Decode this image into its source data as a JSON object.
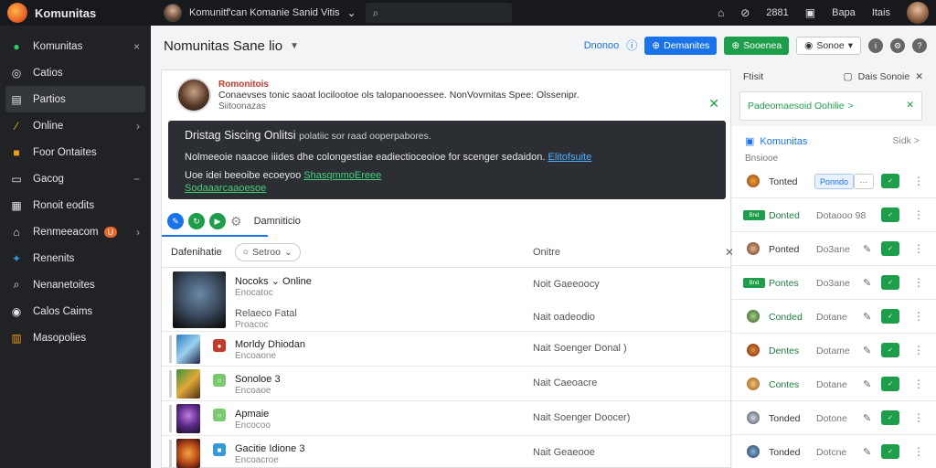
{
  "topbar": {
    "brand": "Komunitas",
    "community": "Komunitf'can Komanie Sanid Vitis",
    "counter": "2881",
    "label_a": "Bapa",
    "label_b": "Itais"
  },
  "sidebar": {
    "items": [
      {
        "label": "Komunitas",
        "icon": "community-icon",
        "right": "×"
      },
      {
        "label": "Catios",
        "icon": "search-icon",
        "right": ""
      },
      {
        "label": "Partios",
        "icon": "document-icon",
        "right": ""
      },
      {
        "label": "Online",
        "icon": "link-icon",
        "right": "›"
      },
      {
        "label": "Foor Ontaites",
        "icon": "folder-icon",
        "right": ""
      },
      {
        "label": "Gacog",
        "icon": "video-icon",
        "right": "−"
      },
      {
        "label": "Ronoit eodits",
        "icon": "list-icon",
        "right": ""
      },
      {
        "label": "Renmeeacom",
        "icon": "home-icon",
        "right": "›",
        "badge": "U"
      },
      {
        "label": "Renenits",
        "icon": "plugin-icon",
        "right": ""
      },
      {
        "label": "Nenanetoites",
        "icon": "magnifier-icon",
        "right": ""
      },
      {
        "label": "Calos Caims",
        "icon": "globe-icon",
        "right": ""
      },
      {
        "label": "Masopolies",
        "icon": "grid-icon",
        "right": ""
      }
    ]
  },
  "header": {
    "title": "Nomunitas Sane lio",
    "link": "Dnonoo",
    "btn_blue": "Demanites",
    "btn_green": "Sooenea",
    "btn_outline": "Sonoe"
  },
  "notice": {
    "title": "Romonitois",
    "text": "Conaevses tonic saoat locilootoe ols talopanooessee. NonVovmitas Spee: Olssenipr.",
    "sub": "Siitoonazas"
  },
  "dark_panel": {
    "title": "Dristag Siscing Onlitsi",
    "title_small": "polatiic sor raad ooperpabores.",
    "line1": "Nolmeeoie naacoe iiides dhe colongestiae eadiectioceoioe for scenger sedaidon.",
    "line1_link": "Elitofsuite",
    "line2": "Uoe idei beeoibe ecoeyoo",
    "line2_link": "ShasqmmoEreee",
    "line3_link": "Sodaaarcaaoesoe"
  },
  "toolbar": {
    "label": "Damniticio"
  },
  "filter": {
    "label": "Dafenihatie",
    "pill": "Setroo",
    "column": "Onitre"
  },
  "list": {
    "first": {
      "name": "Nocoks",
      "name_suffix": "Online",
      "sub": "Enocatoc",
      "sub2": "Relaeco Fatal",
      "sub3": "Proacoc",
      "status": "Noit Gaeeoocy",
      "status2": "Nait oadeodio"
    },
    "rows": [
      {
        "name": "Morldy Dhiodan",
        "sub": "Encoaone",
        "status": "Nait Soenger Donal )"
      },
      {
        "name": "Sonoloe",
        "suffix": "3",
        "sub": "Encoaoe",
        "status": "Nait Caeoacre"
      },
      {
        "name": "Apmaie",
        "sub": "Encocoo",
        "status": "Nait Soenger Doocer)"
      },
      {
        "name": "Gacitie",
        "suffix": "Idione 3",
        "sub": "Encoacroe",
        "status": "Nait Geaeooe"
      }
    ]
  },
  "right_panel": {
    "head_left": "Ftisit",
    "head_right": "Dais Sonoie",
    "card": "Padeomaesoid Oohilie",
    "card_arrow": ">",
    "section_title": "Komunitas",
    "section_sub": "Bnsiooe",
    "section_right": "Sidk",
    "section_right_arrow": ">",
    "rows": [
      {
        "name": "Tonted",
        "button": "Ponndo",
        "dots": "···",
        "kind": "avatar",
        "plain": true
      },
      {
        "name": "Donted",
        "date": "Dotaooo 98",
        "kind": "pill",
        "pill": "Bnd",
        "plain": false
      },
      {
        "name": "Ponted",
        "date": "Do3ane",
        "kind": "avatar",
        "plain": true
      },
      {
        "name": "Pontes",
        "date": "Do3ane",
        "kind": "pill",
        "pill": "Bnd",
        "plain": false
      },
      {
        "name": "Conded",
        "date": "Dotane",
        "kind": "avatar",
        "plain": false
      },
      {
        "name": "Dentes",
        "date": "Dotame",
        "kind": "avatar",
        "plain": false
      },
      {
        "name": "Contes",
        "date": "Dotane",
        "kind": "avatar",
        "plain": false
      },
      {
        "name": "Tonded",
        "date": "Dotone",
        "kind": "avatar",
        "plain": true
      },
      {
        "name": "Tonded",
        "date": "Dotcne",
        "kind": "avatar",
        "plain": true
      }
    ]
  }
}
